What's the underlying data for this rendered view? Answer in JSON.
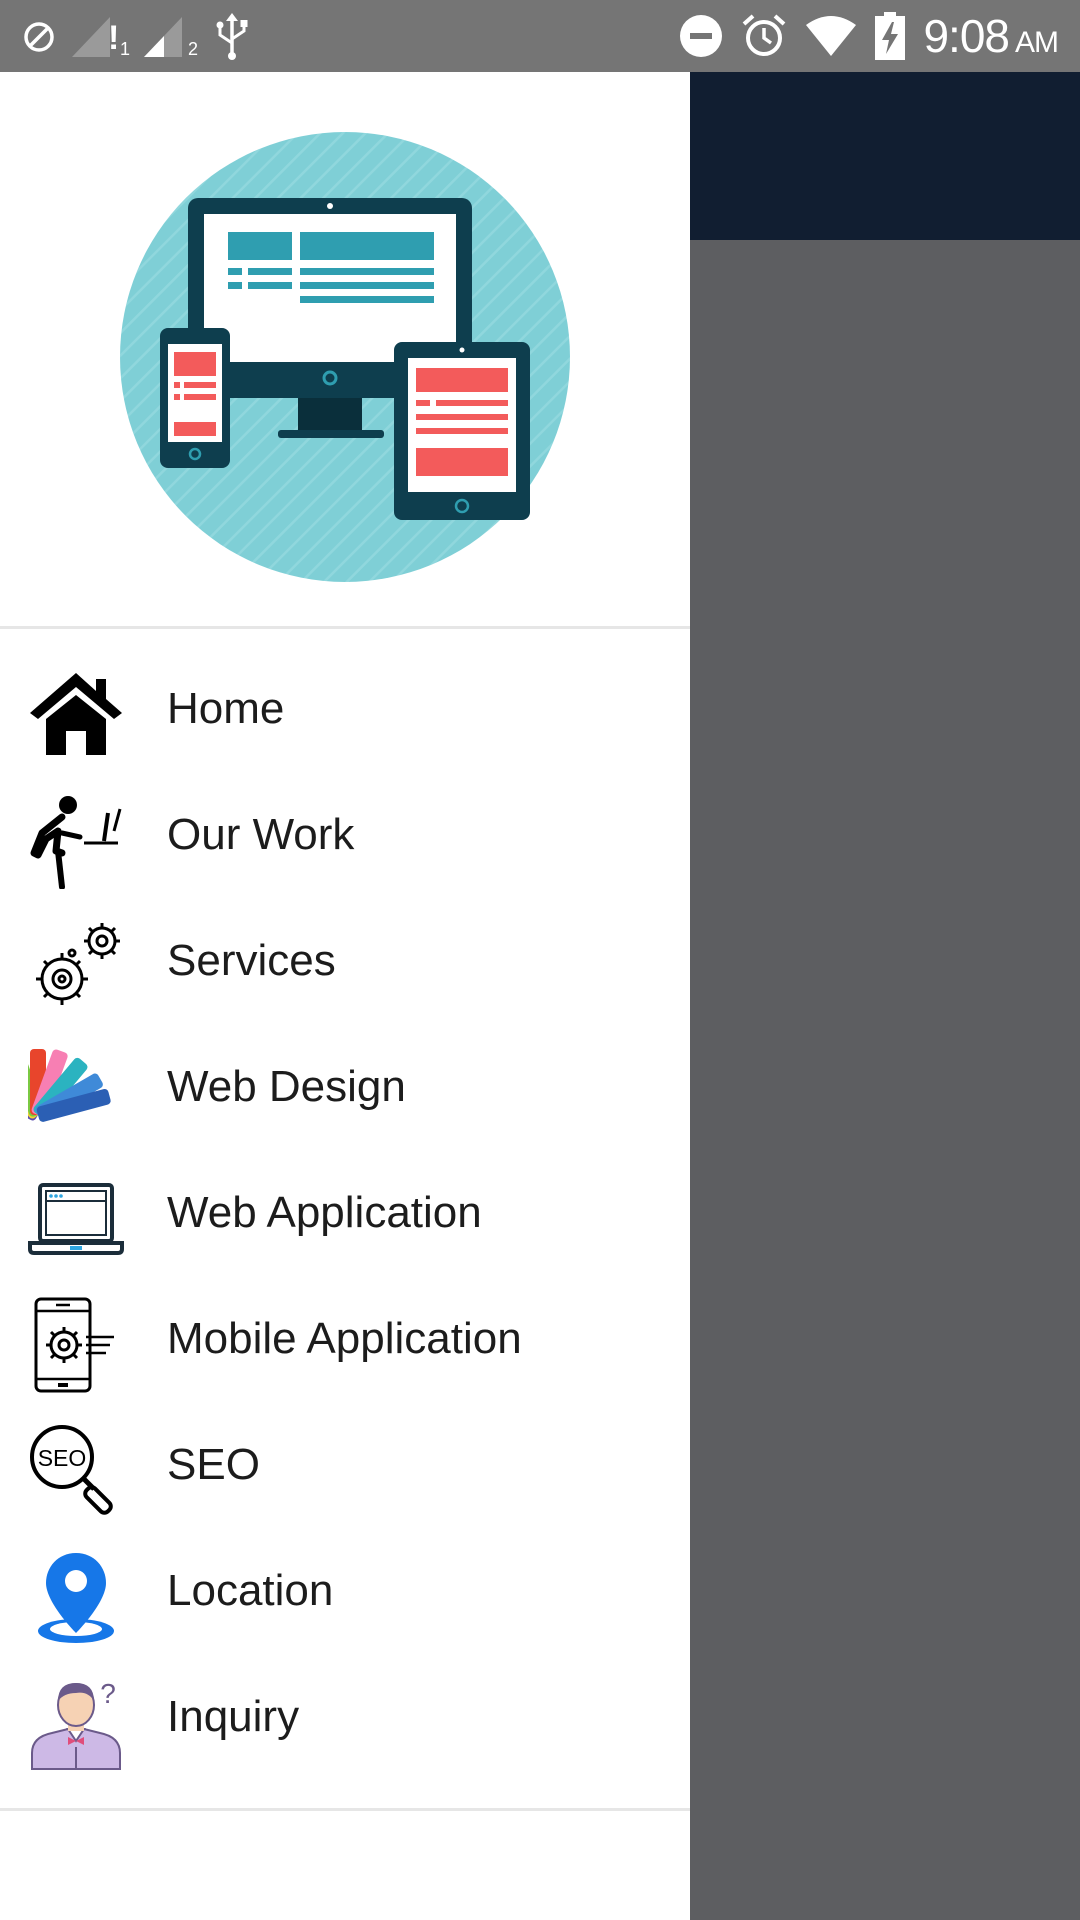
{
  "status_bar": {
    "time": "9:08",
    "ampm": "AM",
    "left_icons": [
      "do-not-disturb-icon",
      "signal-1-icon",
      "signal-2-icon",
      "usb-icon"
    ],
    "right_icons": [
      "minus-circle-icon",
      "alarm-icon",
      "wifi-icon",
      "battery-charging-icon"
    ]
  },
  "drawer": {
    "header_image": "responsive-devices-logo",
    "menu": [
      {
        "label": "Home",
        "icon": "home-icon"
      },
      {
        "label": "Our Work",
        "icon": "person-at-desk-icon"
      },
      {
        "label": "Services",
        "icon": "gears-icon"
      },
      {
        "label": "Web Design",
        "icon": "color-palette-icon"
      },
      {
        "label": "Web Application",
        "icon": "laptop-icon"
      },
      {
        "label": "Mobile Application",
        "icon": "mobile-settings-icon"
      },
      {
        "label": "SEO",
        "icon": "seo-magnifier-icon"
      },
      {
        "label": "Location",
        "icon": "location-pin-icon"
      },
      {
        "label": "Inquiry",
        "icon": "person-question-icon"
      }
    ]
  },
  "colors": {
    "status_bar": "#757575",
    "app_bar": "#111e31",
    "scrim": "#5d5e61",
    "logo_circle": "#7fcfd6",
    "logo_dark": "#0e3e4e",
    "logo_red": "#f35b5b",
    "logo_teal": "#2f9eb0",
    "location_blue": "#1677e8"
  },
  "sb_glyphs": {
    "signal_1_sub": "1",
    "signal_2_sub": "2",
    "signal_alert": "!"
  }
}
